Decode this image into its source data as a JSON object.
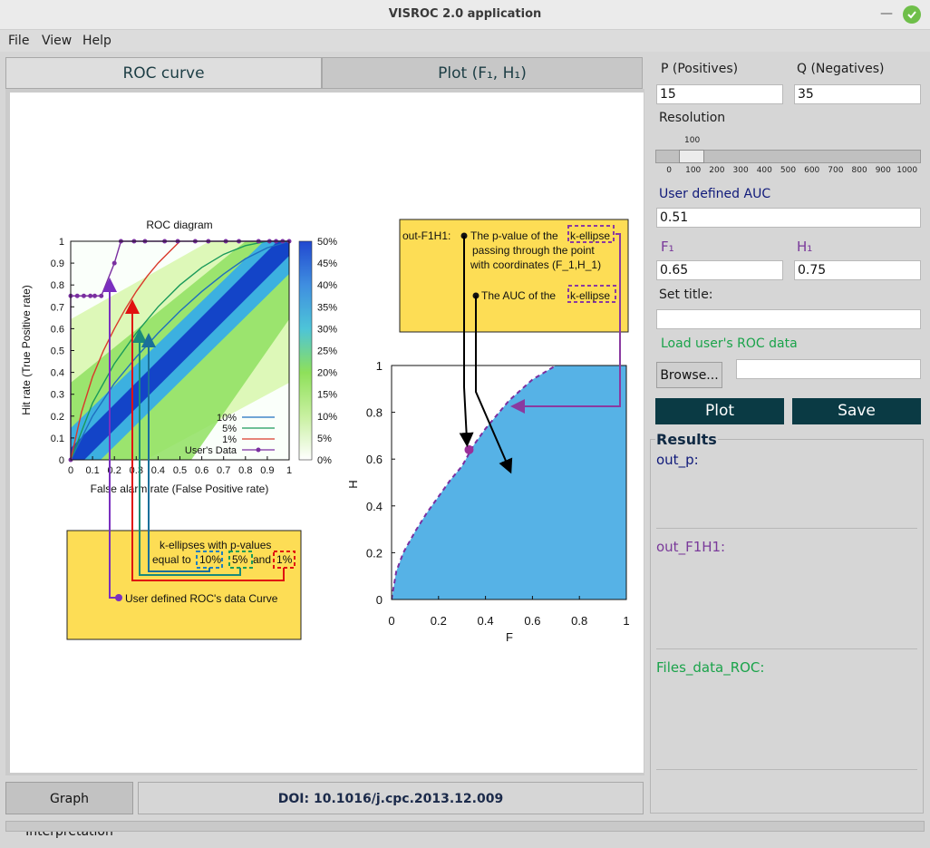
{
  "window": {
    "title": "VISROC 2.0 application",
    "minimize_glyph": "—"
  },
  "menu": {
    "file": "File",
    "view": "View",
    "help": "Help"
  },
  "tabs": {
    "roc": "ROC curve",
    "plot": "Plot (F₁, H₁)"
  },
  "inputs": {
    "p_label": "P (Positives)",
    "p_value": "15",
    "q_label": "Q (Negatives)",
    "q_value": "35",
    "resolution_label": "Resolution",
    "resolution_value": "100",
    "resolution_ticks": [
      "0",
      "100",
      "200",
      "300",
      "400",
      "500",
      "600",
      "700",
      "800",
      "900",
      "1000"
    ],
    "auc_label": "User defined AUC",
    "auc_value": "0.51",
    "f1_label": "F₁",
    "f1_value": "0.65",
    "h1_label": "H₁",
    "h1_value": "0.75",
    "title_label": "Set title:",
    "title_value": "",
    "load_label": "Load user's ROC data",
    "browse": "Browse...",
    "file_value": ""
  },
  "buttons": {
    "plot": "Plot",
    "save": "Save",
    "interpretation": "Graph Interpretation"
  },
  "doi": "DOI: 10.1016/j.cpc.2013.12.009",
  "results": {
    "title": "Results",
    "out_p": "out_p:",
    "out_f1h1": "out_F1H1:",
    "files": "Files_data_ROC:"
  },
  "colors": {
    "accent_dark": "#0a3a44",
    "purple": "#7a3a9a",
    "green": "#1aa34a",
    "navy": "#101a7a",
    "ellipse_fill": "#56b2e6",
    "annotation_bg": "#fddd55"
  },
  "chart_data": [
    {
      "type": "line",
      "title": "ROC diagram",
      "xlabel": "False alarm rate (False Positive rate)",
      "ylabel": "Hit rate (True Positive rate)",
      "xlim": [
        0,
        1
      ],
      "ylim": [
        0,
        1
      ],
      "xticks": [
        "0",
        "0.1",
        "0.2",
        "0.3",
        "0.4",
        "0.5",
        "0.6",
        "0.7",
        "0.8",
        "0.9",
        "1"
      ],
      "yticks": [
        "0",
        "0.1",
        "0.2",
        "0.3",
        "0.4",
        "0.5",
        "0.6",
        "0.7",
        "0.8",
        "0.9",
        "1"
      ],
      "colorbar_ticks": [
        "0%",
        "5%",
        "10%",
        "15%",
        "20%",
        "25%",
        "30%",
        "35%",
        "40%",
        "45%",
        "50%"
      ],
      "legend_position": "bottom-right",
      "series": [
        {
          "name": "10%",
          "color": "#1f6fbf",
          "x": [
            0,
            0.1,
            0.2,
            0.3,
            0.4,
            0.5,
            0.6,
            0.7,
            0.8,
            0.9,
            1
          ],
          "y": [
            0,
            0.2,
            0.35,
            0.47,
            0.58,
            0.68,
            0.77,
            0.85,
            0.92,
            0.97,
            1
          ]
        },
        {
          "name": "5%",
          "color": "#1a9a5a",
          "x": [
            0,
            0.1,
            0.2,
            0.3,
            0.4,
            0.5,
            0.6,
            0.7,
            0.8,
            0.9,
            1
          ],
          "y": [
            0,
            0.26,
            0.44,
            0.58,
            0.7,
            0.8,
            0.88,
            0.94,
            0.98,
            1,
            1
          ]
        },
        {
          "name": "1%",
          "color": "#d93a2b",
          "x": [
            0,
            0.05,
            0.1,
            0.15,
            0.2,
            0.25,
            0.3,
            0.35,
            0.4,
            0.45,
            0.5
          ],
          "y": [
            0,
            0.22,
            0.38,
            0.5,
            0.6,
            0.69,
            0.77,
            0.84,
            0.9,
            0.95,
            1
          ]
        },
        {
          "name": "User's Data",
          "color": "#7a2fa0",
          "x": [
            0,
            0,
            0.03,
            0.06,
            0.09,
            0.11,
            0.14,
            0.2,
            0.23,
            0.29,
            0.34,
            0.43,
            0.49,
            0.57,
            0.63,
            0.71,
            0.77,
            0.86,
            0.91,
            0.94,
            0.97,
            1
          ],
          "y": [
            0,
            0.75,
            0.75,
            0.75,
            0.75,
            0.75,
            0.75,
            0.9,
            1,
            1,
            1,
            1,
            1,
            1,
            1,
            1,
            1,
            1,
            1,
            1,
            1,
            1
          ]
        }
      ],
      "annotation": {
        "line1": "k-ellipses with p-values",
        "line2_prefix": "equal to",
        "p10": "10%",
        "p5": "5%",
        "and": "and",
        "p1": "1%",
        "user_curve": "User defined ROC's data Curve"
      }
    },
    {
      "type": "area",
      "xlabel": "F",
      "ylabel": "H",
      "xlim": [
        0,
        1
      ],
      "ylim": [
        0,
        1
      ],
      "xticks": [
        "0",
        "0.2",
        "0.4",
        "0.6",
        "0.8",
        "1"
      ],
      "yticks": [
        "0",
        "0.2",
        "0.4",
        "0.6",
        "0.8",
        "1"
      ],
      "point": {
        "F": 0.33,
        "H": 0.64
      },
      "boundary": {
        "x": [
          0,
          0.02,
          0.05,
          0.1,
          0.15,
          0.2,
          0.25,
          0.3,
          0.35,
          0.4,
          0.5,
          0.6,
          0.7
        ],
        "y": [
          0,
          0.12,
          0.2,
          0.29,
          0.37,
          0.44,
          0.51,
          0.57,
          0.66,
          0.73,
          0.85,
          0.94,
          1
        ]
      },
      "annotation": {
        "label": "out-F1H1:",
        "line1a": "The p-value of the",
        "keyword": "k-ellipse",
        "line2": "passing through the point",
        "line3": "with coordinates (F_1,H_1)",
        "line4a": "The  AUC of the",
        "line4b": "k-ellipse"
      }
    }
  ]
}
